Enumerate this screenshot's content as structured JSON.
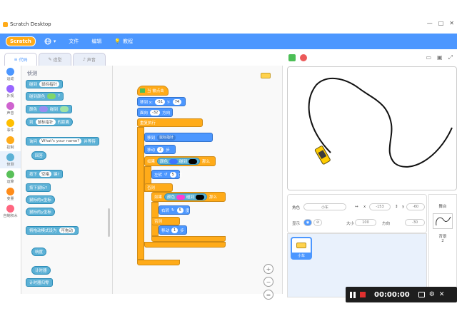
{
  "window": {
    "title": "Scratch Desktop",
    "controls": [
      "—",
      "□",
      "✕"
    ]
  },
  "menubar": {
    "logo": "Scratch",
    "items": [
      "文件",
      "编辑",
      "教程"
    ]
  },
  "tabs": [
    {
      "label": "代码",
      "icon": "code-icon"
    },
    {
      "label": "造型",
      "icon": "brush-icon"
    },
    {
      "label": "声音",
      "icon": "speaker-icon"
    }
  ],
  "categories": [
    {
      "label": "运动",
      "color": "#4c97ff"
    },
    {
      "label": "外观",
      "color": "#9966ff"
    },
    {
      "label": "声音",
      "color": "#cf63cf"
    },
    {
      "label": "事件",
      "color": "#ffbf00"
    },
    {
      "label": "控制",
      "color": "#ffab19"
    },
    {
      "label": "侦测",
      "color": "#5cb1d6"
    },
    {
      "label": "运算",
      "color": "#59c059"
    },
    {
      "label": "变量",
      "color": "#ff8c1a"
    },
    {
      "label": "自制积木",
      "color": "#ff6680"
    }
  ],
  "palette": {
    "title": "侦测",
    "blocks": [
      {
        "text": "碰到",
        "arg": "鼠标指针",
        "type": "bool"
      },
      {
        "text": "碰到颜色",
        "arg": "?",
        "type": "bool"
      },
      {
        "text": "颜色",
        "arg": "碰到",
        "type": "bool"
      },
      {
        "text": "到",
        "arg": "鼠标指针",
        "suffix": "的距离",
        "type": "rep"
      },
      {
        "text": "询问",
        "arg": "What's your name?",
        "suffix": "并等待",
        "type": "stack"
      },
      {
        "text": "回答",
        "type": "rep"
      },
      {
        "text": "按下",
        "arg": "空格",
        "suffix": "键?",
        "type": "bool"
      },
      {
        "text": "按下鼠标?",
        "type": "bool"
      },
      {
        "text": "鼠标的x坐标",
        "type": "rep"
      },
      {
        "text": "鼠标的y坐标",
        "type": "rep"
      },
      {
        "text": "将拖动模式设为",
        "arg": "可拖动",
        "type": "stack"
      },
      {
        "text": "响度",
        "type": "rep"
      },
      {
        "text": "计时器",
        "type": "rep"
      },
      {
        "text": "计时器归零",
        "type": "stack"
      }
    ]
  },
  "script": {
    "hat": "当 被点击",
    "goto_x": "-51",
    "goto_y": "74",
    "turn": "-32",
    "forever": "重复执行",
    "goto_label": "移到 x:",
    "y_label": "y:",
    "face_label": "面向",
    "face_unit": "方向",
    "repeat_label": "移到",
    "repeat_arg": "鼠标指针",
    "move_label": "移动",
    "move_steps": "2",
    "move_unit": "步",
    "if_label": "如果",
    "color_label": "颜色",
    "touch_label": "碰到",
    "then_label": "那么",
    "turn_left_label": "左转",
    "turn_left_val": "5",
    "turn_left_unit": "度",
    "turn_right_label": "右转",
    "turn_right_val": "5",
    "turn_right_unit": "度",
    "else_label": "否则",
    "step_label": "移动",
    "step_val": "1",
    "step_unit": "步"
  },
  "stage_header": {
    "flag": "green-flag-icon",
    "stop": "stop-icon"
  },
  "sprite_info": {
    "sprite_label": "角色",
    "sprite_name": "小车",
    "x_label": "x",
    "x_value": "-153",
    "y_label": "y",
    "y_value": "-60",
    "show_label": "显示",
    "size_label": "大小",
    "size_value": "100",
    "direction_label": "方向",
    "direction_value": "-30"
  },
  "sprite_tile": {
    "label": "小车"
  },
  "backdrop": {
    "title": "舞台",
    "count_label": "背景",
    "count": "2"
  },
  "recorder": {
    "time": "00:00:00"
  }
}
